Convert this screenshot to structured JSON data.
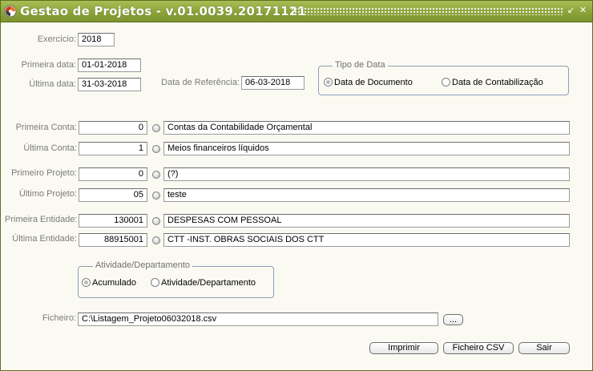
{
  "window": {
    "title": "Gestao de Projetos - v.01.0039.20171121",
    "controls": {
      "minimize_glyph": "↙",
      "close_glyph": "✕"
    }
  },
  "form": {
    "exercicio": {
      "label": "Exercício:",
      "value": "2018"
    },
    "primeira_data": {
      "label": "Primeira data:",
      "value": "01-01-2018"
    },
    "ultima_data": {
      "label": "Última data:",
      "value": "31-03-2018"
    },
    "data_referencia": {
      "label": "Data de Referência:",
      "value": "06-03-2018"
    },
    "tipo_data": {
      "legend": "Tipo de Data",
      "options": [
        "Data de Documento",
        "Data de Contabilização"
      ],
      "selected": "Data de Documento"
    },
    "primeira_conta": {
      "label": "Primeira Conta:",
      "code": "0",
      "description": "Contas da Contabilidade Orçamental"
    },
    "ultima_conta": {
      "label": "Última Conta:",
      "code": "1",
      "description": "Meios financeiros líquidos"
    },
    "primeiro_projeto": {
      "label": "Primeiro Projeto:",
      "code": "0",
      "description": "(?)"
    },
    "ultimo_projeto": {
      "label": "Último Projeto:",
      "code": "05",
      "description": "teste"
    },
    "primeira_entidade": {
      "label": "Primeira Entidade:",
      "code": "130001",
      "description": "DESPESAS COM PESSOAL"
    },
    "ultima_entidade": {
      "label": "Última Entidade:",
      "code": "88915001",
      "description": "CTT -INST. OBRAS SOCIAIS DOS CTT"
    },
    "atividade": {
      "legend": "Atividade/Departamento",
      "options": [
        "Acumulado",
        "Atividade/Departamento"
      ],
      "selected": "Acumulado"
    },
    "ficheiro": {
      "label": "Ficheiro:",
      "value": "C:\\Listagem_Projeto06032018.csv",
      "browse_label": "..."
    }
  },
  "buttons": {
    "imprimir": "Imprimir",
    "ficheiro_csv": "Ficheiro CSV",
    "sair": "Sair"
  },
  "colors": {
    "titlebar": "#89a136",
    "window_bg": "#fbfaf2",
    "group_border": "#8aa0b8"
  }
}
